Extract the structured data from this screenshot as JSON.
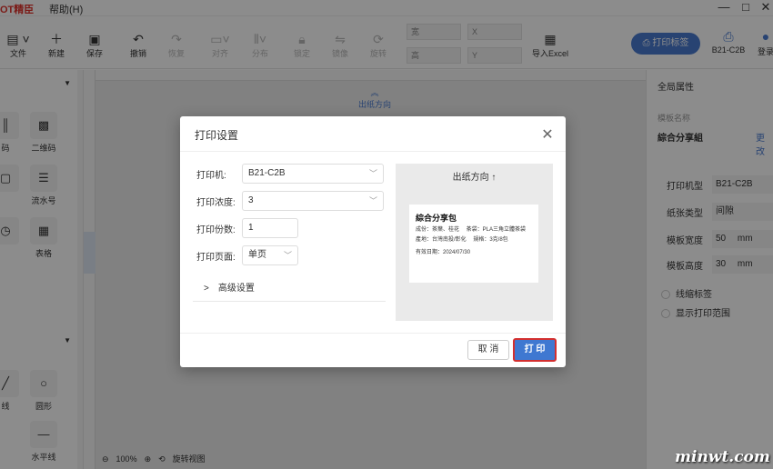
{
  "app": {
    "brand": "OT精臣",
    "menu_help": "帮助(H)"
  },
  "window_controls": {
    "minimize": "—",
    "restore": "□",
    "close": "✕"
  },
  "toolbar": {
    "file": "文件",
    "new": "新建",
    "save": "保存",
    "undo": "撤销",
    "redo": "恢复",
    "align": "对齐",
    "distribute": "分布",
    "lock": "锁定",
    "mirror": "镜像",
    "rotate": "旋转",
    "width_label": "宽",
    "height_label": "高",
    "x_label": "X",
    "y_label": "Y",
    "import_excel": "导入Excel",
    "print_label": "打印标签",
    "device": "B21-C2B",
    "login": "登录"
  },
  "left_panel": {
    "items": [
      {
        "label": "码"
      },
      {
        "label": "二维码"
      },
      {
        "label": ""
      },
      {
        "label": "流水号"
      },
      {
        "label": ""
      },
      {
        "label": "表格"
      },
      {
        "label": "线"
      },
      {
        "label": "圆形"
      },
      {
        "label": "水平线"
      }
    ]
  },
  "canvas": {
    "feed_direction": "出纸方向",
    "zoom": "100%",
    "rotate_view": "旋转视图"
  },
  "right_panel": {
    "title": "全局属性",
    "template_name_label": "模板名称",
    "template_name": "綜合分享組",
    "edit": "更改",
    "printer_label": "打印机型",
    "printer_value": "B21-C2B",
    "paper_label": "纸张类型",
    "paper_value": "间隙",
    "width_label": "模板宽度",
    "width_value": "50",
    "width_unit": "mm",
    "height_label": "模板高度",
    "height_value": "30",
    "height_unit": "mm",
    "crop_mark": "线缩标签",
    "show_print_range": "显示打印范围"
  },
  "dialog": {
    "title": "打印设置",
    "printer_label": "打印机:",
    "printer_value": "B21-C2B",
    "density_label": "打印浓度:",
    "density_value": "3",
    "copies_label": "打印份数:",
    "copies_value": "1",
    "page_label": "打印页面:",
    "page_value": "单页",
    "advanced": "高级设置",
    "preview_direction": "出纸方向 ↑",
    "label_title": "綜合分享包",
    "label_line1": "成份：茶葉、桂花　 茶袋：PLA三角立體茶袋",
    "label_line2": "產地：台灣南投/彰化　 規格：3克/8包",
    "label_line3": "有效日期：2024/07/30",
    "cancel": "取 消",
    "print": "打 印"
  },
  "watermark": "minwt.com"
}
